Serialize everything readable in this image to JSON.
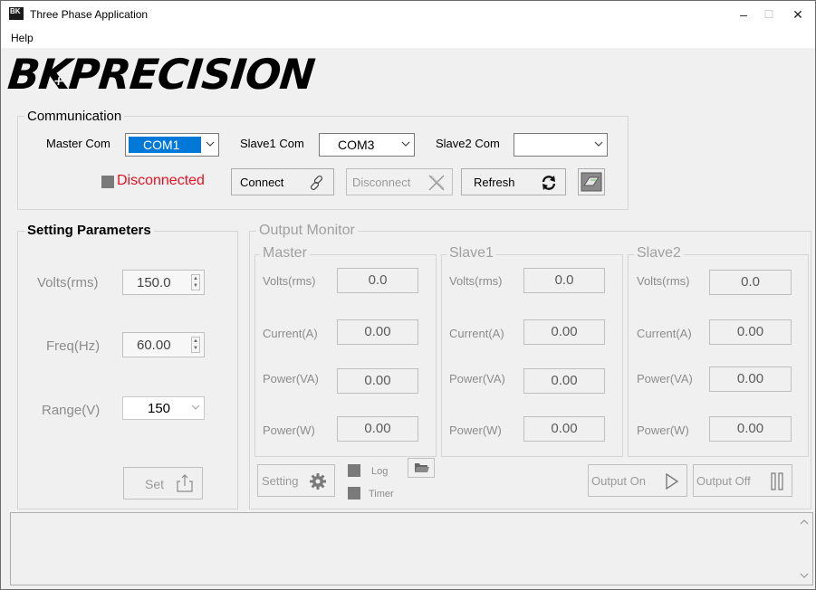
{
  "window": {
    "title": "Three Phase Application",
    "icon_label": "BK",
    "minimize": "–",
    "maximize": "☐",
    "close": "✕"
  },
  "menu": {
    "help": "Help"
  },
  "logo": {
    "text": "BK PRECISION",
    "part1": "BK",
    "part2": "PRECISION"
  },
  "communication": {
    "title": "Communication",
    "master_label": "Master Com",
    "master_value": "COM1",
    "slave1_label": "Slave1 Com",
    "slave1_value": "COM3",
    "slave2_label": "Slave2 Com",
    "slave2_value": "",
    "status": "Disconnected",
    "status_color": "#e81123",
    "connect_label": "Connect",
    "disconnect_label": "Disconnect",
    "refresh_label": "Refresh"
  },
  "settings": {
    "title": "Setting Parameters",
    "volts_label": "Volts(rms)",
    "volts_value": "150.0",
    "freq_label": "Freq(Hz)",
    "freq_value": "60.00",
    "range_label": "Range(V)",
    "range_value": "150",
    "set_label": "Set"
  },
  "monitor": {
    "title": "Output Monitor",
    "groups": [
      {
        "name": "Master",
        "rows": [
          {
            "label": "Volts(rms)",
            "value": "0.0"
          },
          {
            "label": "Current(A)",
            "value": "0.00"
          },
          {
            "label": "Power(VA)",
            "value": "0.00"
          },
          {
            "label": "Power(W)",
            "value": "0.00"
          }
        ]
      },
      {
        "name": "Slave1",
        "rows": [
          {
            "label": "Volts(rms)",
            "value": "0.0"
          },
          {
            "label": "Current(A)",
            "value": "0.00"
          },
          {
            "label": "Power(VA)",
            "value": "0.00"
          },
          {
            "label": "Power(W)",
            "value": "0.00"
          }
        ]
      },
      {
        "name": "Slave2",
        "rows": [
          {
            "label": "Volts(rms)",
            "value": "0.0"
          },
          {
            "label": "Current(A)",
            "value": "0.00"
          },
          {
            "label": "Power(VA)",
            "value": "0.00"
          },
          {
            "label": "Power(W)",
            "value": "0.00"
          }
        ]
      }
    ],
    "setting_label": "Setting",
    "log_label": "Log",
    "timer_label": "Timer",
    "output_on_label": "Output On",
    "output_off_label": "Output Off"
  },
  "colors": {
    "accent": "#0078d7",
    "window_bg": "#f0f0f0",
    "disabled_text": "#8c8c8c"
  }
}
